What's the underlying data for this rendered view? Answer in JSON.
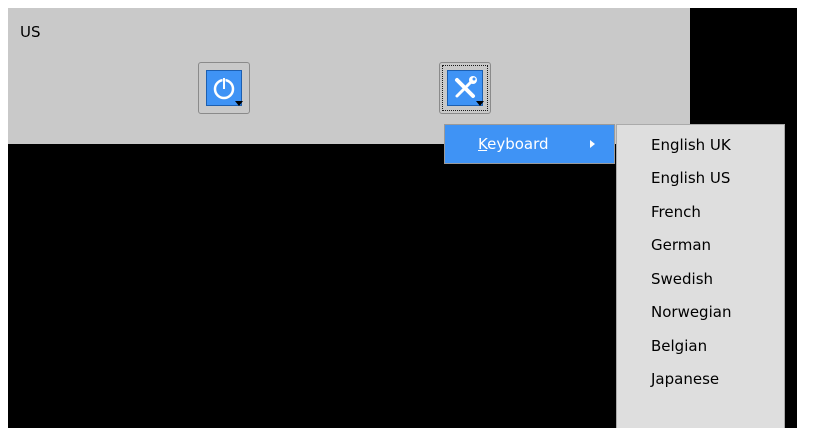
{
  "login_panel": {
    "layout_indicator": "US",
    "power_button": {
      "icon": "power-icon"
    },
    "tools_button": {
      "icon": "tools-icon"
    }
  },
  "keyboard_menu": {
    "item_mnemonic": "K",
    "item_rest": "eyboard",
    "submenu_arrow_icon": "chevron-right-icon"
  },
  "language_menu": {
    "items": [
      "English UK",
      "English US",
      "French",
      "German",
      "Swedish",
      "Norwegian",
      "Belgian",
      "Japanese"
    ]
  },
  "colors": {
    "panel_bg": "#c9c9c9",
    "accent": "#3f93f5",
    "menu_bg": "#dedede",
    "screen_bg": "#000000"
  }
}
